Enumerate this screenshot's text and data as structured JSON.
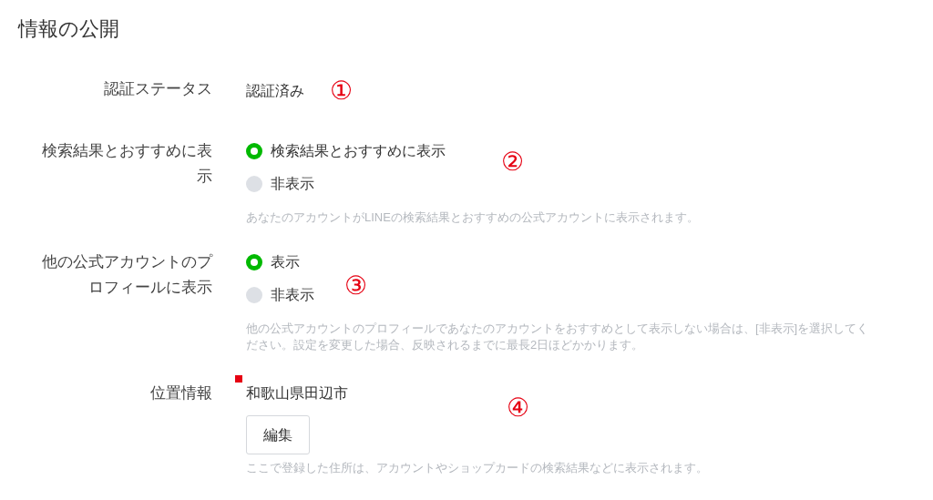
{
  "title": "情報の公開",
  "rows": [
    {
      "kind": "text",
      "label": "認証ステータス",
      "value": "認証済み",
      "annotation": "①"
    },
    {
      "kind": "radio",
      "label": "検索結果とおすすめに表示",
      "annotation": "②",
      "options": [
        {
          "label": "検索結果とおすすめに表示",
          "selected": true
        },
        {
          "label": "非表示",
          "selected": false
        }
      ],
      "help": "あなたのアカウントがLINEの検索結果とおすすめの公式アカウントに表示されます。"
    },
    {
      "kind": "radio",
      "label": "他の公式アカウントのプロフィールに表示",
      "annotation": "③",
      "options": [
        {
          "label": "表示",
          "selected": true
        },
        {
          "label": "非表示",
          "selected": false
        }
      ],
      "help": "他の公式アカウントのプロフィールであなたのアカウントをおすすめとして表示しない場合は、[非表示]を選択してください。設定を変更した場合、反映されるまでに最長2日ほどかかります。"
    },
    {
      "kind": "edit",
      "label": "位置情報",
      "required": true,
      "value": "和歌山県田辺市",
      "button": "編集",
      "annotation": "④",
      "help": "ここで登録した住所は、アカウントやショップカードの検索結果などに表示されます。"
    }
  ]
}
